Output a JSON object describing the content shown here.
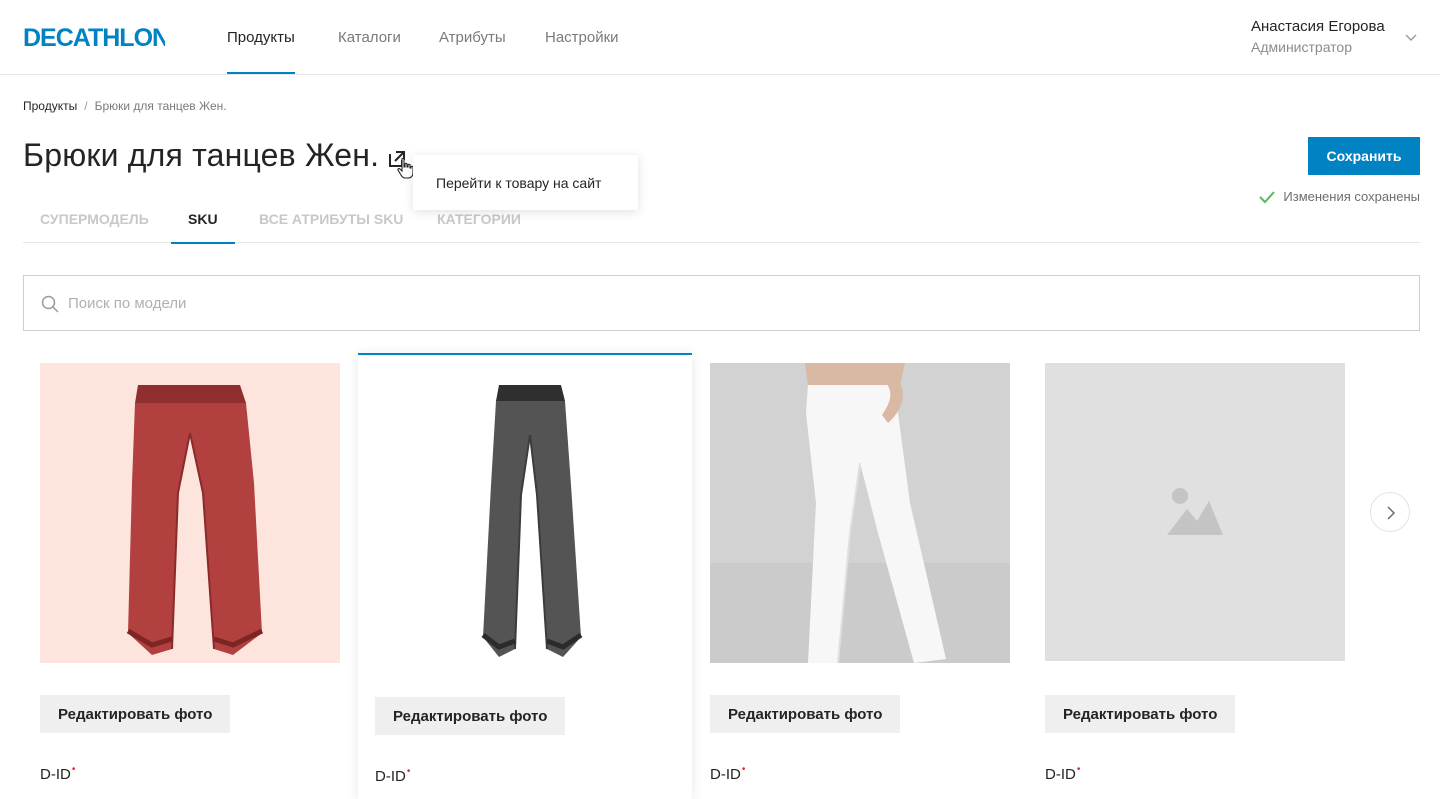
{
  "header": {
    "logo_text": "DECATHLON",
    "nav": [
      "Продукты",
      "Каталоги",
      "Атрибуты",
      "Настройки"
    ],
    "user_name": "Анастасия Егорова",
    "user_role": "Администратор"
  },
  "breadcrumb": {
    "root": "Продукты",
    "separator": "/",
    "current": "Брюки для танцев Жен."
  },
  "page": {
    "title": "Брюки для танцев Жен.",
    "tooltip": "Перейти к товару на сайт",
    "save_label": "Сохранить",
    "saved_status": "Изменения сохранены"
  },
  "tabs": [
    "Супермодель",
    "SKU",
    "Все атрибуты SKU",
    "Категории"
  ],
  "search": {
    "placeholder": "Поиск по модели"
  },
  "cards": [
    {
      "edit_label": "Редактировать фото",
      "did_label": "D-ID",
      "required_mark": "•"
    },
    {
      "edit_label": "Редактировать фото",
      "did_label": "D-ID",
      "required_mark": "•"
    },
    {
      "edit_label": "Редактировать фото",
      "did_label": "D-ID",
      "required_mark": "•"
    },
    {
      "edit_label": "Редактировать фото",
      "did_label": "D-ID",
      "required_mark": "•"
    }
  ],
  "colors": {
    "accent": "#0082c3",
    "brand": "#0082c3",
    "success": "#5cb85c",
    "required": "#e3262f"
  },
  "icons": [
    "external-link-icon",
    "cursor-hand-icon",
    "search-icon",
    "checkmark-icon",
    "chevron-down-icon",
    "chevron-right-icon",
    "image-placeholder-icon"
  ]
}
